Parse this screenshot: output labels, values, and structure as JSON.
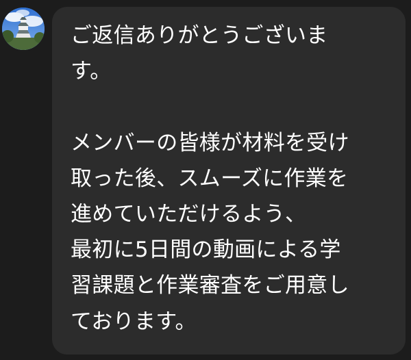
{
  "chat": {
    "sender": {
      "avatar_icon": "castle-photo-avatar"
    },
    "message": {
      "lines": [
        "ご返信ありがとうございま",
        "す。",
        "",
        "メンバーの皆様が材料を受け",
        "取った後、スムーズに作業を",
        "進めていただけるよう、",
        "最初に5日間の動画による学",
        "習課題と作業審査をご用意し",
        "ております。"
      ]
    }
  },
  "colors": {
    "background": "#1c1c1c",
    "bubble": "#2c2c2c",
    "text": "#ffffff"
  }
}
